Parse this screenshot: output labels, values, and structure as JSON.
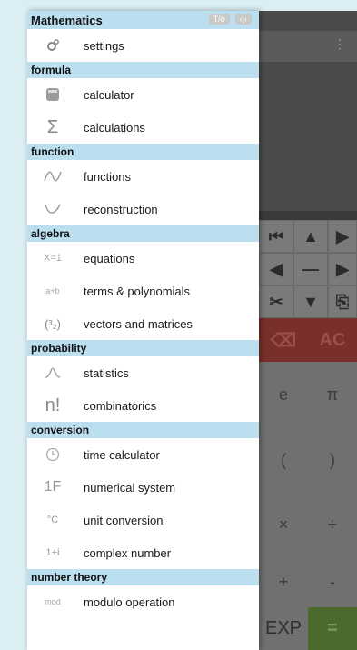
{
  "drawer": {
    "title": "Mathematics",
    "status": [
      "T/o",
      "‹¦‹"
    ],
    "top_items": [
      {
        "label": "settings",
        "icon": "gear-icon"
      }
    ],
    "sections": [
      {
        "title": "formula",
        "items": [
          {
            "label": "calculator",
            "icon": "calculator-icon"
          },
          {
            "label": "calculations",
            "icon": "sigma-icon",
            "glyph": "Σ"
          }
        ]
      },
      {
        "title": "function",
        "items": [
          {
            "label": "functions",
            "icon": "function-curve-icon"
          },
          {
            "label": "reconstruction",
            "icon": "reconstruction-curve-icon"
          }
        ]
      },
      {
        "title": "algebra",
        "items": [
          {
            "label": "equations",
            "icon": "equation-icon",
            "glyph": "X=1"
          },
          {
            "label": "terms & polynomials",
            "icon": "terms-icon",
            "glyph": "a+b"
          },
          {
            "label": "vectors and matrices",
            "icon": "vector-icon",
            "glyph": "(³₂)"
          }
        ]
      },
      {
        "title": "probability",
        "items": [
          {
            "label": "statistics",
            "icon": "statistics-curve-icon"
          },
          {
            "label": "combinatorics",
            "icon": "factorial-icon",
            "glyph": "n!"
          }
        ]
      },
      {
        "title": "conversion",
        "items": [
          {
            "label": "time calculator",
            "icon": "clock-icon"
          },
          {
            "label": "numerical system",
            "icon": "numeral-system-icon",
            "glyph": "1F"
          },
          {
            "label": "unit conversion",
            "icon": "thermometer-icon",
            "glyph": "°C"
          },
          {
            "label": "complex number",
            "icon": "complex-number-icon",
            "glyph": "1+i"
          }
        ]
      },
      {
        "title": "number theory",
        "items": [
          {
            "label": "modulo operation",
            "icon": "mod-icon",
            "glyph": "mod"
          }
        ]
      }
    ]
  },
  "calculator": {
    "nav_keys": [
      "⏮",
      "▲",
      "▶",
      "◀",
      "—",
      "▶",
      "✂",
      "▼",
      "⎘"
    ],
    "delete_label": "⌫",
    "clear_label": "AC",
    "keys": [
      "e",
      "π",
      "(",
      ")",
      "×",
      "÷",
      "+",
      "-"
    ],
    "exp_label": "EXP",
    "equals_label": "="
  }
}
